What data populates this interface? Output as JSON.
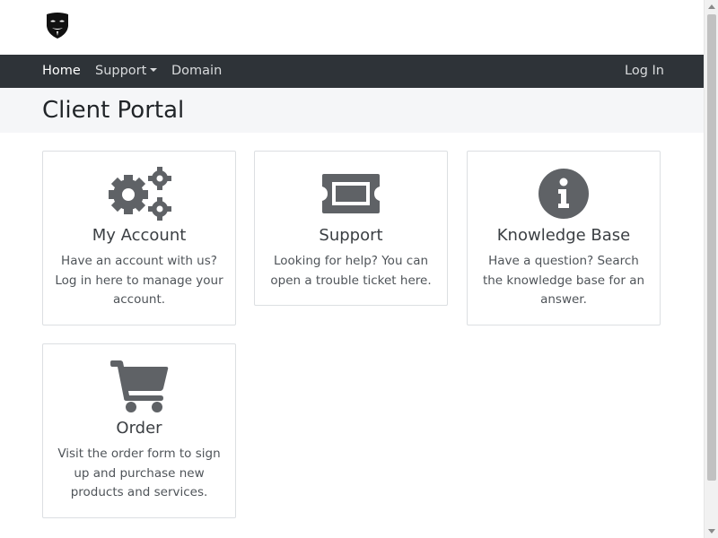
{
  "nav": {
    "home": "Home",
    "support": "Support",
    "domain": "Domain",
    "login": "Log In"
  },
  "page": {
    "title": "Client Portal"
  },
  "cards": [
    {
      "title": "My Account",
      "text": "Have an account with us? Log in here to manage your account.",
      "icon": "gears-icon"
    },
    {
      "title": "Support",
      "text": "Looking for help? You can open a trouble ticket here.",
      "icon": "ticket-icon"
    },
    {
      "title": "Knowledge Base",
      "text": "Have a question? Search the knowledge base for an answer.",
      "icon": "info-circle-icon"
    },
    {
      "title": "Order",
      "text": "Visit the order form to sign up and purchase new products and services.",
      "icon": "shopping-cart-icon"
    }
  ],
  "colors": {
    "navbar": "#2e3338",
    "icon": "#5f6266",
    "header_bg": "#f5f6f8"
  }
}
